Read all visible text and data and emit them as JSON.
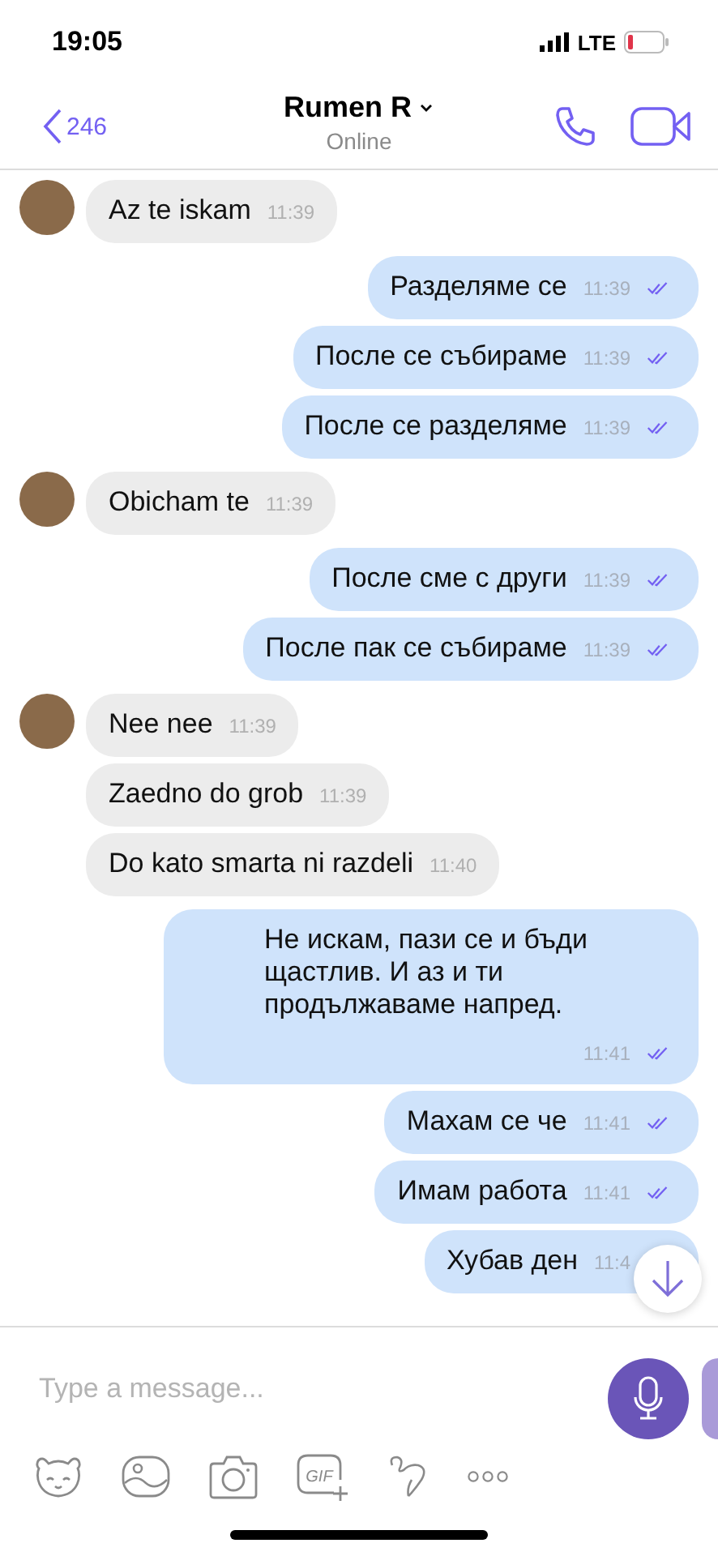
{
  "status_bar": {
    "time": "19:05",
    "network": "LTE"
  },
  "header": {
    "back_count": "246",
    "name": "Rumen R",
    "status": "Online"
  },
  "messages": [
    {
      "kind": "in",
      "avatar": true,
      "text": "Az te iskam",
      "time": "11:39"
    },
    {
      "kind": "out",
      "text": "Разделяме се",
      "time": "11:39"
    },
    {
      "kind": "out",
      "text": "После се събираме",
      "time": "11:39"
    },
    {
      "kind": "out",
      "text": "После се разделяме",
      "time": "11:39"
    },
    {
      "kind": "in",
      "avatar": true,
      "text": "Obicham te",
      "time": "11:39"
    },
    {
      "kind": "out",
      "text": "После сме с други",
      "time": "11:39"
    },
    {
      "kind": "out",
      "text": "После пак се събираме",
      "time": "11:39"
    },
    {
      "kind": "in",
      "avatar": true,
      "text": "Nee nee",
      "time": "11:39"
    },
    {
      "kind": "in",
      "avatar": false,
      "text": "Zaedno do grob",
      "time": "11:39"
    },
    {
      "kind": "in",
      "avatar": false,
      "text": "Do kato smarta ni razdeli",
      "time": "11:40"
    },
    {
      "kind": "out",
      "text": "Не искам, пази се и бъди щастлив. И аз и ти продължаваме напред.",
      "time": "11:41"
    },
    {
      "kind": "out",
      "text": "Махам се че",
      "time": "11:41"
    },
    {
      "kind": "out",
      "text": "Имам работа",
      "time": "11:41"
    },
    {
      "kind": "out",
      "text": "Хубав ден",
      "time": "11:4"
    }
  ],
  "composer": {
    "placeholder": "Type a message...",
    "tools": [
      {
        "kind": "sticker"
      },
      {
        "kind": "gallery"
      },
      {
        "kind": "camera"
      },
      {
        "kind": "gif",
        "label": "GIF"
      },
      {
        "kind": "doodle"
      },
      {
        "kind": "more"
      }
    ]
  }
}
